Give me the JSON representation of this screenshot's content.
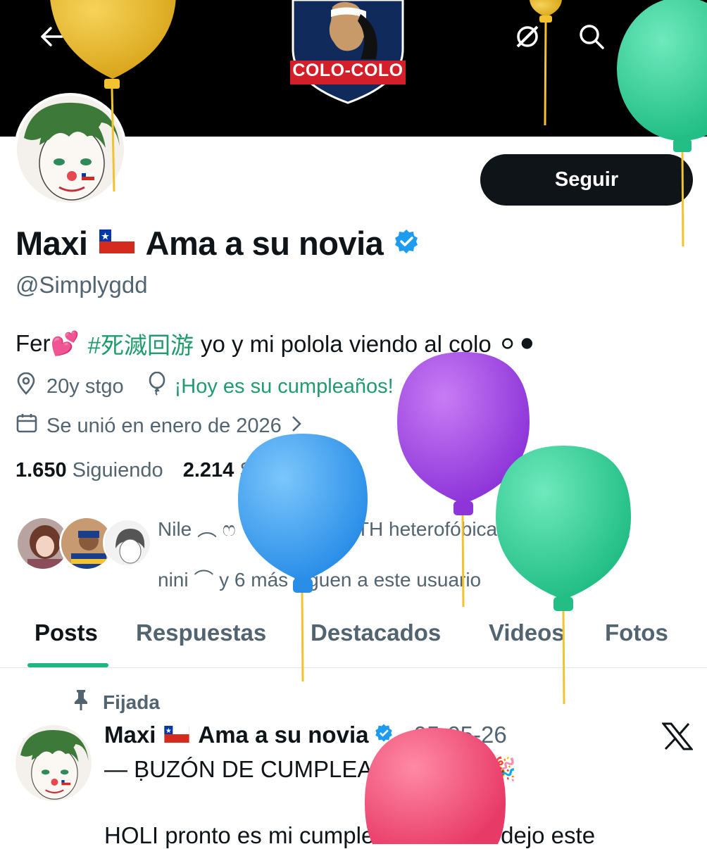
{
  "header": {
    "banner_club_label": "COLO-COLO",
    "back_icon": "arrow-left-icon",
    "grok_icon": "grok-icon",
    "search_icon": "search-icon",
    "more_icon": "more-icon"
  },
  "profile": {
    "follow_label": "Seguir",
    "name_part1": "Maxi",
    "name_part2": "Ama a su novia",
    "verified_icon": "verified-badge-icon",
    "handle": "@Simplygdd",
    "bio_prefix": "Fer💕",
    "bio_hashtag": "#死滅回游",
    "bio_suffix": "yo y mi polola viendo al colo ⚪⚫",
    "location": "20y stgo",
    "birthday": "¡Hoy es su cumpleaños!",
    "joined": "Se unió en enero de 2026",
    "following_count": "1.650",
    "following_label": "Siguiendo",
    "followers_count": "2.214",
    "followers_label": "Seguidores",
    "followed_by_line1": "Nile ︵ ෆ ゜にぇー, NATH heterofóbica desde la cuna,",
    "followed_by_line2": "nini ⌒ y 6 más siguen a este usuario"
  },
  "tabs": [
    {
      "label": "Posts",
      "active": true
    },
    {
      "label": "Respuestas",
      "active": false
    },
    {
      "label": "Destacados",
      "active": false
    },
    {
      "label": "Videos",
      "active": false
    },
    {
      "label": "Fotos",
      "active": false
    }
  ],
  "pinned_post": {
    "pinned_label": "Fijada",
    "author_part1": "Maxi",
    "author_part2": "Ama a su novia",
    "date": "· 05-05-26",
    "line1": "— ḄUZÓN DE CUMPLEAÑOS ‼️🎂🎉",
    "line2": "HOLI pronto es mi cumple es el 26/05 dejo este"
  },
  "colors": {
    "accent_green": "#1fb584",
    "verified_blue": "#1d9bf0",
    "balloon_yellow": "#e6b823",
    "balloon_purple": "#a64de6",
    "balloon_blue": "#3fa4f5",
    "balloon_green": "#34d39b",
    "balloon_pink": "#f0507a"
  }
}
